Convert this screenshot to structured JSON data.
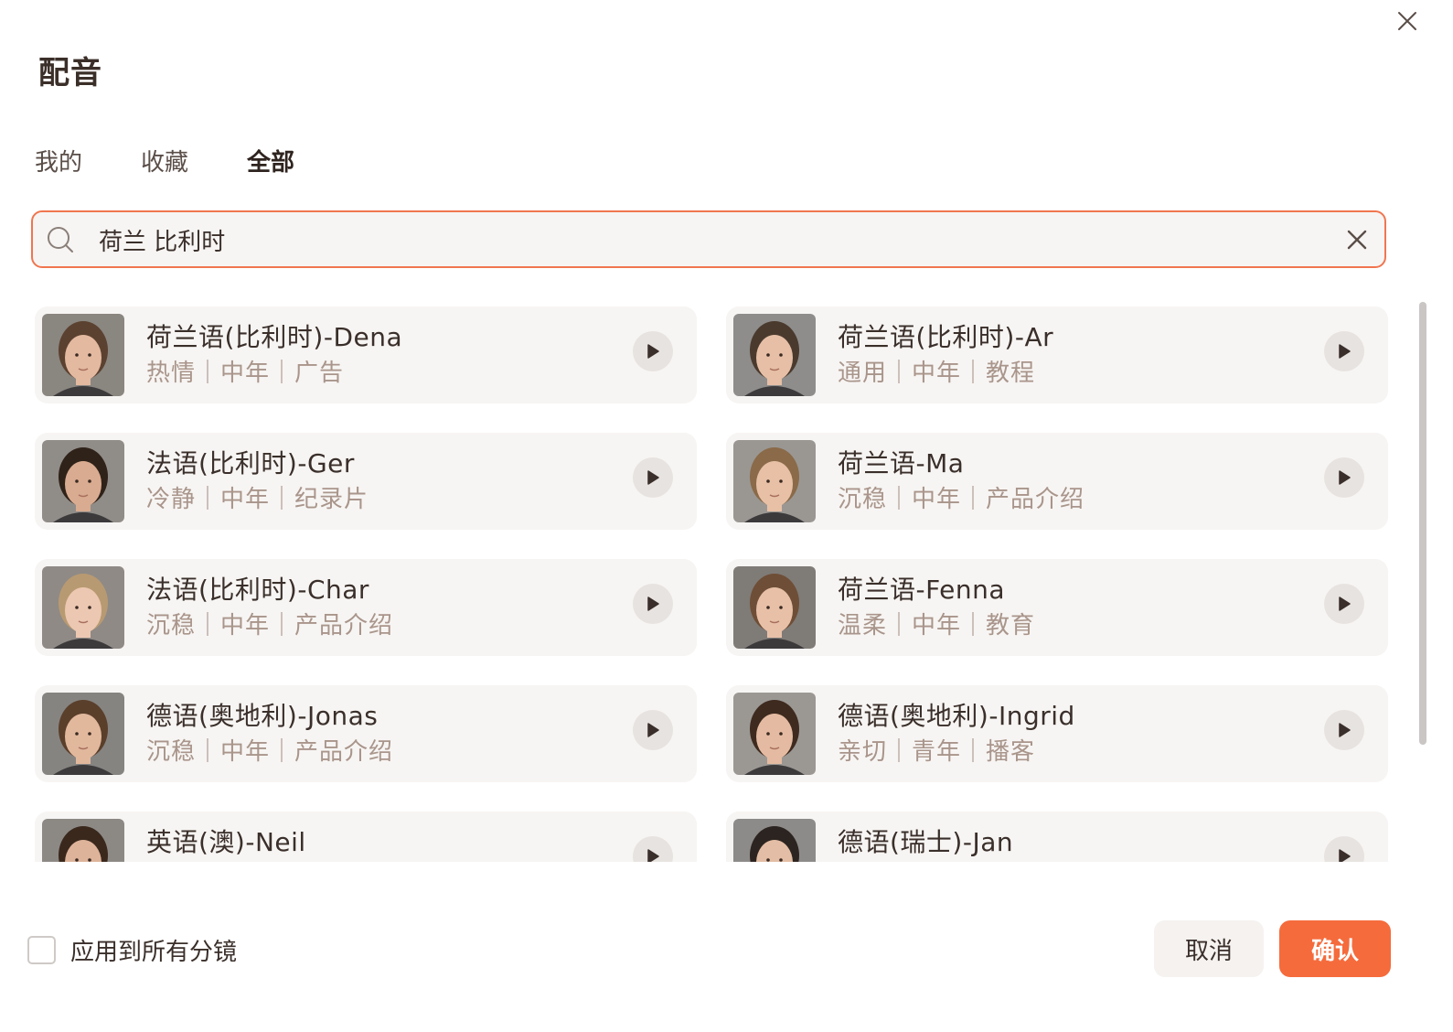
{
  "dialog": {
    "title": "配音",
    "close_icon": "close-icon"
  },
  "tabs": [
    {
      "label": "我的",
      "active": false
    },
    {
      "label": "收藏",
      "active": false
    },
    {
      "label": "全部",
      "active": true
    }
  ],
  "search": {
    "value": "荷兰 比利时",
    "icon": "search-icon",
    "clear_icon": "close-icon"
  },
  "voices": [
    {
      "name": "荷兰语(比利时)-Dena",
      "tags": "热情｜中年｜广告",
      "hair": "#5b4130",
      "skin": "#e3b9a0",
      "bg": "#8a8680"
    },
    {
      "name": "荷兰语(比利时)-Ar",
      "tags": "通用｜中年｜教程",
      "hair": "#4a3a2e",
      "skin": "#e6bfa6",
      "bg": "#8e8d8b"
    },
    {
      "name": "法语(比利时)-Ger",
      "tags": "冷静｜中年｜纪录片",
      "hair": "#2f2219",
      "skin": "#d9ab90",
      "bg": "#908c88"
    },
    {
      "name": "荷兰语-Ma",
      "tags": "沉稳｜中年｜产品介绍",
      "hair": "#8a6a48",
      "skin": "#e7c0a6",
      "bg": "#9a9793"
    },
    {
      "name": "法语(比利时)-Char",
      "tags": "沉稳｜中年｜产品介绍",
      "hair": "#b89a72",
      "skin": "#ecc8b2",
      "bg": "#8f8a86"
    },
    {
      "name": "荷兰语-Fenna",
      "tags": "温柔｜中年｜教育",
      "hair": "#6e4e36",
      "skin": "#e8c0a8",
      "bg": "#7f7b77"
    },
    {
      "name": "德语(奥地利)-Jonas",
      "tags": "沉稳｜中年｜产品介绍",
      "hair": "#5a3f2b",
      "skin": "#e2b89d",
      "bg": "#868481"
    },
    {
      "name": "德语(奥地利)-Ingrid",
      "tags": "亲切｜青年｜播客",
      "hair": "#3e2a1f",
      "skin": "#e4bba2",
      "bg": "#9b9894"
    },
    {
      "name": "英语(澳)-Neil",
      "tags": "",
      "hair": "#3a281d",
      "skin": "#ddb39a",
      "bg": "#8c8985"
    },
    {
      "name": "德语(瑞士)-Jan",
      "tags": "",
      "hair": "#2c2420",
      "skin": "#e3bda5",
      "bg": "#8d8b89"
    }
  ],
  "footer": {
    "apply_all_label": "应用到所有分镜",
    "apply_all_checked": false,
    "cancel_label": "取消",
    "confirm_label": "确认"
  },
  "colors": {
    "accent": "#f56b3c",
    "search_border": "#f0764f",
    "card_bg": "#f7f5f3",
    "tag_text": "#a9958b"
  }
}
